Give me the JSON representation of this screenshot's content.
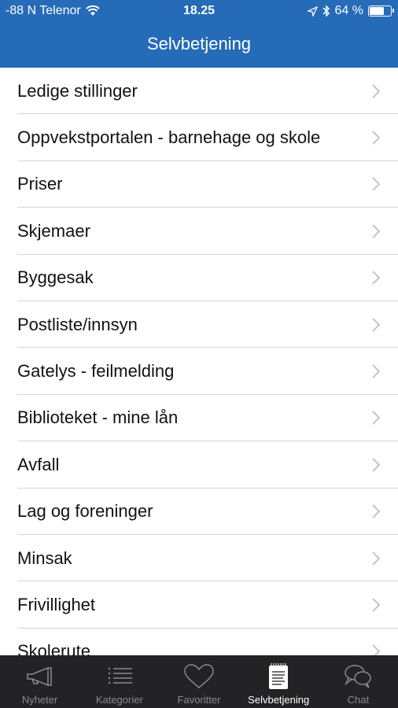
{
  "status_bar": {
    "carrier": "-88 N Telenor",
    "time": "18.25",
    "battery_label": "64 %",
    "battery_level": 0.64
  },
  "navbar": {
    "title": "Selvbetjening"
  },
  "list": {
    "items": [
      {
        "label": "Ledige stillinger"
      },
      {
        "label": "Oppvekstportalen - barnehage og skole"
      },
      {
        "label": "Priser"
      },
      {
        "label": "Skjemaer"
      },
      {
        "label": "Byggesak"
      },
      {
        "label": "Postliste/innsyn"
      },
      {
        "label": "Gatelys - feilmelding"
      },
      {
        "label": "Biblioteket - mine lån"
      },
      {
        "label": "Avfall"
      },
      {
        "label": "Lag og foreninger"
      },
      {
        "label": "Minsak"
      },
      {
        "label": "Frivillighet"
      },
      {
        "label": "Skolerute"
      }
    ]
  },
  "tab_bar": {
    "tabs": [
      {
        "label": "Nyheter",
        "icon": "megaphone-icon"
      },
      {
        "label": "Kategorier",
        "icon": "list-icon"
      },
      {
        "label": "Favoritter",
        "icon": "heart-icon"
      },
      {
        "label": "Selvbetjening",
        "icon": "notepad-icon",
        "active": true
      },
      {
        "label": "Chat",
        "icon": "chat-bubbles-icon"
      }
    ]
  }
}
